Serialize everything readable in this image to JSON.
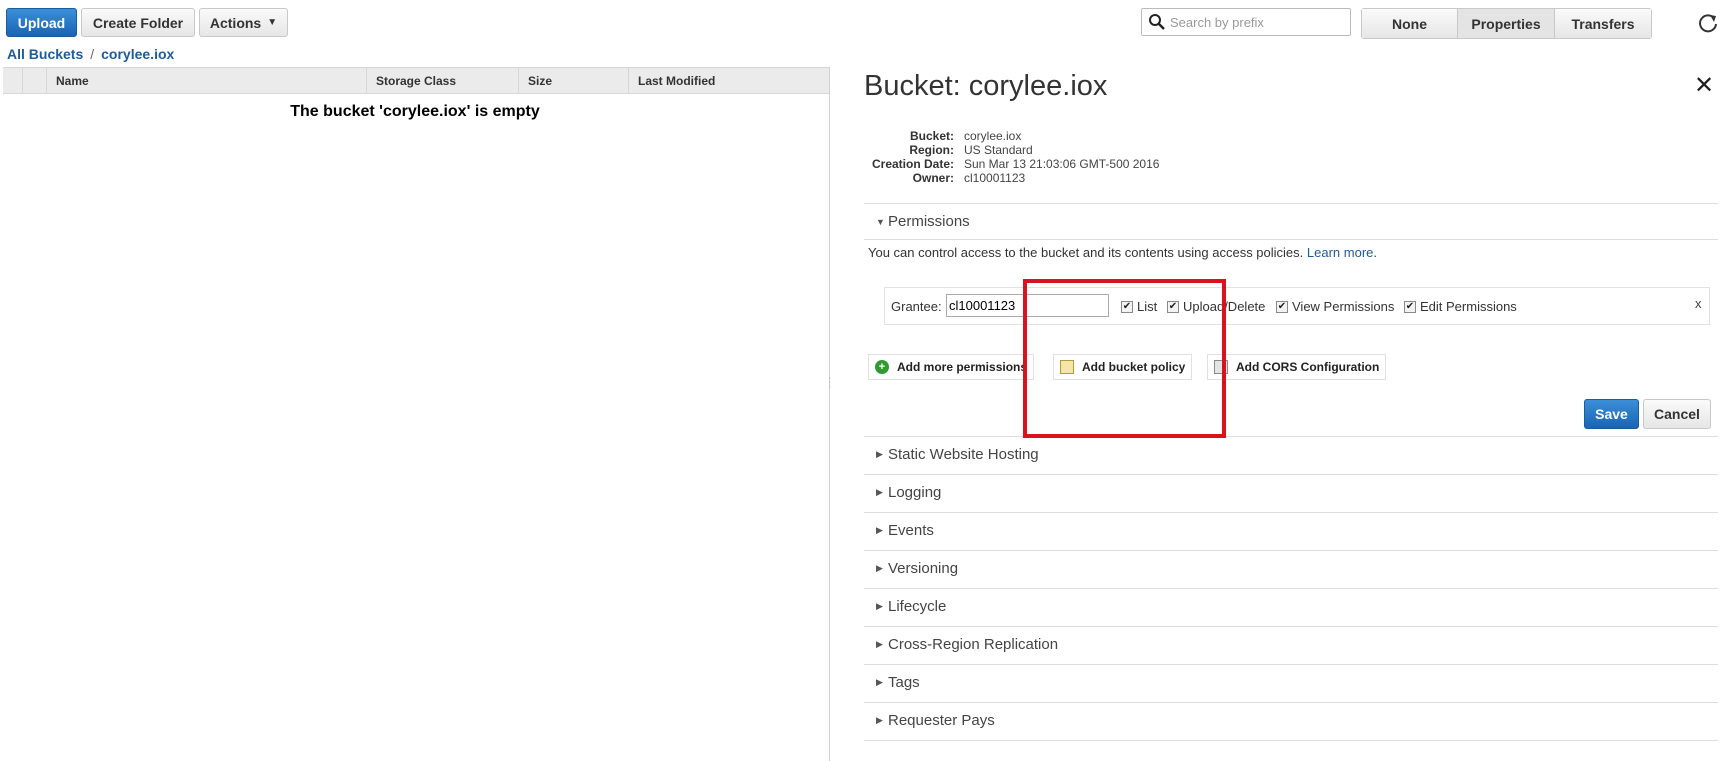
{
  "toolbar": {
    "upload": "Upload",
    "create_folder": "Create Folder",
    "actions": "Actions",
    "search_placeholder": "Search by prefix",
    "views": [
      "None",
      "Properties",
      "Transfers"
    ],
    "active_view": "Properties"
  },
  "breadcrumb": {
    "root": "All Buckets",
    "separator": "/",
    "current": "corylee.iox"
  },
  "grid": {
    "columns": [
      "Name",
      "Storage Class",
      "Size",
      "Last Modified"
    ],
    "empty_message": "The bucket 'corylee.iox' is empty"
  },
  "panel": {
    "title": "Bucket: corylee.iox",
    "close": "✕",
    "info": [
      {
        "key": "Bucket:",
        "value": "corylee.iox"
      },
      {
        "key": "Region:",
        "value": "US Standard"
      },
      {
        "key": "Creation Date:",
        "value": "Sun Mar 13 21:03:06 GMT-500 2016"
      },
      {
        "key": "Owner:",
        "value": "cl10001123"
      }
    ],
    "permissions": {
      "heading": "Permissions",
      "description": "You can control access to the bucket and its contents using access policies.",
      "learn_more": "Learn more",
      "grantee_label": "Grantee:",
      "grantee_value": "cl10001123",
      "checkboxes": [
        {
          "label": "List",
          "checked": true
        },
        {
          "label": "Upload/Delete",
          "checked": true
        },
        {
          "label": "View Permissions",
          "checked": true
        },
        {
          "label": "Edit Permissions",
          "checked": true
        }
      ],
      "remove": "x",
      "add_more": "Add more permissions",
      "add_policy": "Add bucket policy",
      "add_cors": "Add CORS Configuration",
      "save": "Save",
      "cancel": "Cancel"
    },
    "sections": [
      "Static Website Hosting",
      "Logging",
      "Events",
      "Versioning",
      "Lifecycle",
      "Cross-Region Replication",
      "Tags",
      "Requester Pays"
    ]
  },
  "colors": {
    "primary": "#1a64b4",
    "link": "#1e5b9c",
    "highlight": "#d9131d"
  }
}
